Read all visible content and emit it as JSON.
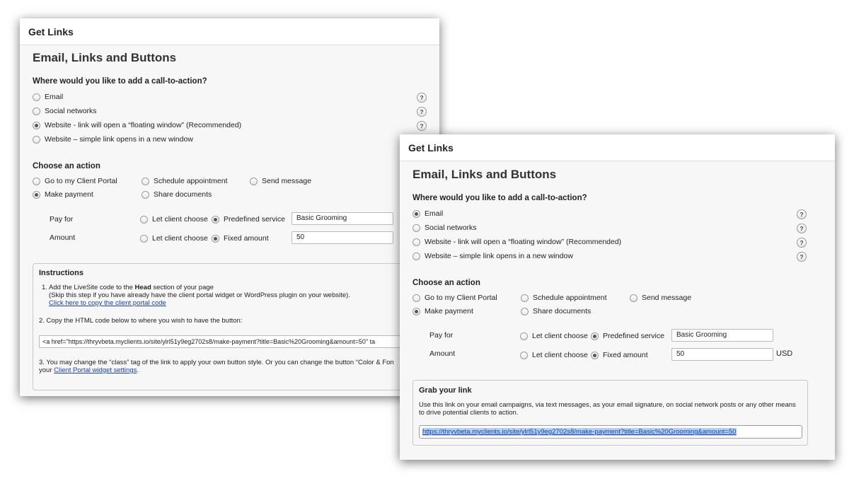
{
  "back": {
    "window_title": "Get Links",
    "heading": "Email, Links and Buttons",
    "cta_question": "Where would you like to add a call-to-action?",
    "cta_options": [
      {
        "label": "Email",
        "selected": false
      },
      {
        "label": "Social networks",
        "selected": false
      },
      {
        "label": "Website - link will open a “floating window” (Recommended)",
        "selected": true
      },
      {
        "label": "Website – simple link opens in a new window",
        "selected": false
      }
    ],
    "help_glyph": "?",
    "action_heading": "Choose an action",
    "actions": [
      {
        "label": "Go to my Client Portal",
        "selected": false
      },
      {
        "label": "Schedule appointment",
        "selected": false
      },
      {
        "label": "Send message",
        "selected": false
      },
      {
        "label": "Make payment",
        "selected": true
      },
      {
        "label": "Share documents",
        "selected": false
      }
    ],
    "pay_for": {
      "label": "Pay for",
      "opt_client": "Let client choose",
      "opt_predefined": "Predefined service",
      "value": "Basic Grooming"
    },
    "amount": {
      "label": "Amount",
      "opt_client": "Let client choose",
      "opt_fixed": "Fixed amount",
      "value": "50"
    },
    "instructions": {
      "title": "Instructions",
      "step1_prefix": "1. Add the LiveSite code to the ",
      "step1_bold": "Head",
      "step1_suffix": " section of your page",
      "step1_note": "(Skip this step if you have already have the client portal widget or WordPress plugin on your website).",
      "step1_link": "Click here to copy the client portal code",
      "step2": "2. Copy the HTML code below to where you wish to have the button:",
      "code": "<a href=\"https://thryvbeta.myclients.io/site/ylrl51y9eg2702s8/make-payment?title=Basic%20Grooming&amount=50\" ta",
      "step3_line1": "3. You may change the “class” tag of the link to apply your own button style. Or you can change the button “Color & Fon",
      "step3_prefix": "your ",
      "step3_link": "Client Portal widget settings",
      "step3_suffix": "."
    }
  },
  "front": {
    "window_title": "Get Links",
    "heading": "Email, Links and Buttons",
    "cta_question": "Where would you like to add a call-to-action?",
    "cta_options": [
      {
        "label": "Email",
        "selected": true
      },
      {
        "label": "Social networks",
        "selected": false
      },
      {
        "label": "Website - link will open a “floating window” (Recommended)",
        "selected": false
      },
      {
        "label": "Website – simple link opens in a new window",
        "selected": false
      }
    ],
    "help_glyph": "?",
    "action_heading": "Choose an action",
    "actions": [
      {
        "label": "Go to my Client Portal",
        "selected": false
      },
      {
        "label": "Schedule appointment",
        "selected": false
      },
      {
        "label": "Send message",
        "selected": false
      },
      {
        "label": "Make payment",
        "selected": true
      },
      {
        "label": "Share documents",
        "selected": false
      }
    ],
    "pay_for": {
      "label": "Pay for",
      "opt_client": "Let client choose",
      "opt_predefined": "Predefined service",
      "value": "Basic Grooming"
    },
    "amount": {
      "label": "Amount",
      "opt_client": "Let client choose",
      "opt_fixed": "Fixed amount",
      "value": "50",
      "currency": "USD"
    },
    "grab": {
      "title": "Grab your link",
      "desc_line1": "Use this link on your email campaigns, via text messages, as your email signature, on social network posts or any other means",
      "desc_line2": "to drive potential clients to action.",
      "url": "https://thryvbeta.myclients.io/site/ylrl51y9eg2702s8/make-payment?title=Basic%20Grooming&amount=50"
    }
  }
}
